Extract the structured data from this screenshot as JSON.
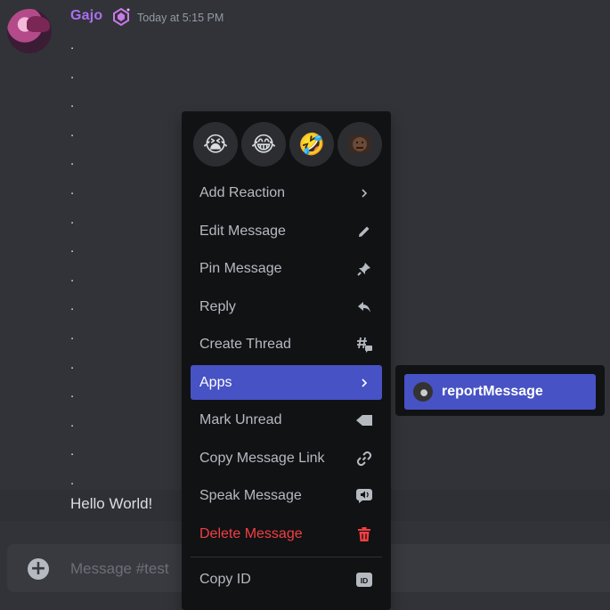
{
  "message": {
    "username": "Gajo",
    "username_color": "#a970f0",
    "timestamp": "Today at 5:15 PM",
    "dot_lines": [
      ".",
      ".",
      ".",
      ".",
      ".",
      ".",
      ".",
      ".",
      ".",
      ".",
      ".",
      ".",
      ".",
      ".",
      ".",
      "."
    ],
    "hello_text": "Hello World!"
  },
  "composer": {
    "placeholder": "Message #test"
  },
  "context_menu": {
    "reactions": [
      {
        "icon": "crying-emoji-icon",
        "glyph": "😭"
      },
      {
        "icon": "joy-emoji-icon",
        "glyph": "😂"
      },
      {
        "icon": "rofl-emoji-icon",
        "glyph": "🤣"
      },
      {
        "icon": "custom-emoji-icon",
        "glyph": ""
      }
    ],
    "items": [
      {
        "label": "Add Reaction",
        "icon": "chevron-right-icon"
      },
      {
        "label": "Edit Message",
        "icon": "pencil-icon"
      },
      {
        "label": "Pin Message",
        "icon": "pin-icon"
      },
      {
        "label": "Reply",
        "icon": "reply-icon"
      },
      {
        "label": "Create Thread",
        "icon": "thread-icon"
      },
      {
        "label": "Apps",
        "icon": "chevron-right-icon",
        "active": true
      },
      {
        "label": "Mark Unread",
        "icon": "mark-unread-icon"
      },
      {
        "label": "Copy Message Link",
        "icon": "link-icon"
      },
      {
        "label": "Speak Message",
        "icon": "speak-icon"
      },
      {
        "label": "Delete Message",
        "icon": "trash-icon",
        "danger": true
      },
      {
        "label": "Copy ID",
        "icon": "id-icon"
      }
    ]
  },
  "apps_submenu": {
    "items": [
      {
        "label": "reportMessage",
        "icon": "app-avatar-icon"
      }
    ]
  },
  "colors": {
    "background": "#313338",
    "menu": "#111214",
    "accent": "#4752c4",
    "danger": "#f23f43"
  }
}
